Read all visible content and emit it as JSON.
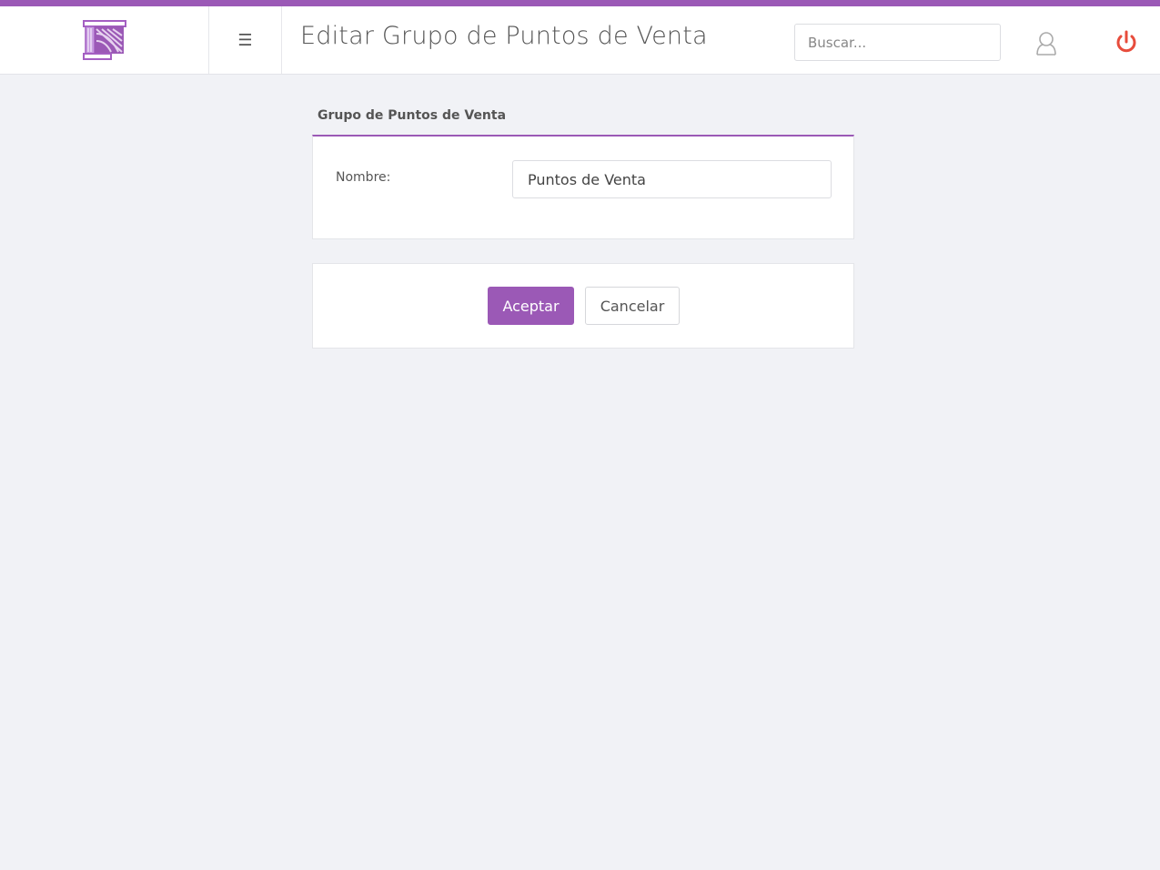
{
  "header": {
    "menu_icon": "☰",
    "title": "Editar Grupo de Puntos de Venta",
    "search": {
      "placeholder": "Buscar...",
      "value": ""
    },
    "user_icon": "user-icon",
    "power_icon": "power-icon"
  },
  "form": {
    "section_title": "Grupo de Puntos de Venta",
    "name_label": "Nombre:",
    "name_value": "Puntos de Venta"
  },
  "actions": {
    "accept_label": "Aceptar",
    "cancel_label": "Cancelar"
  },
  "colors": {
    "accent": "#9b59b6",
    "power": "#e74c3c",
    "background": "#f1f2f6"
  }
}
